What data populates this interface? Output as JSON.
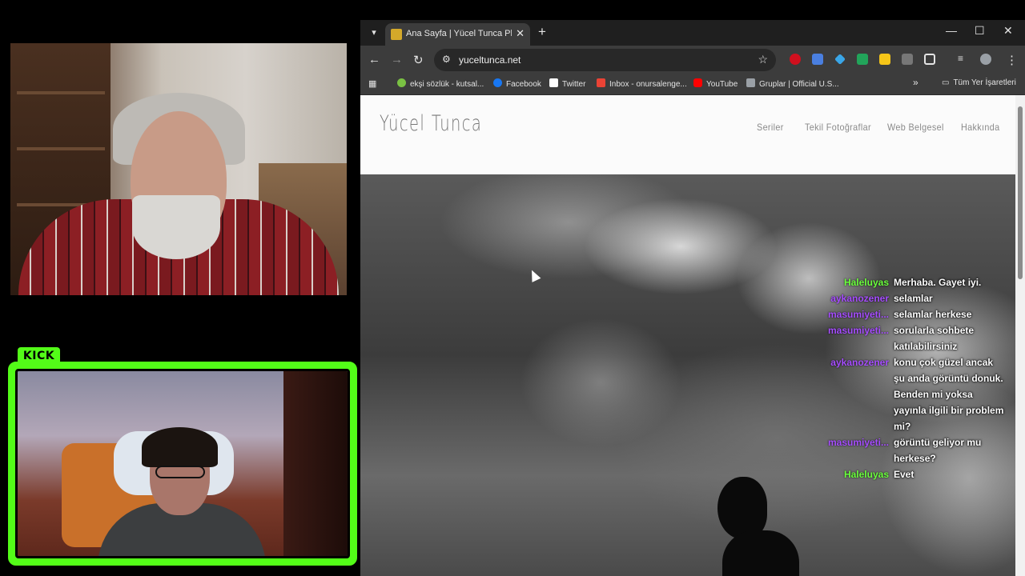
{
  "kick_label": "KICK",
  "browser": {
    "tab_list_icon": "chevron-down-icon",
    "tab": {
      "title": "Ana Sayfa | Yücel Tunca Photog",
      "close": "✕"
    },
    "new_tab": "+",
    "window_controls": {
      "minimize": "—",
      "maximize": "☐",
      "close": "✕"
    },
    "address": {
      "url": "yuceltunca.net"
    },
    "bookmarks": [
      {
        "label": "ekşi sözlük - kutsal...",
        "color": "#7ac143"
      },
      {
        "label": "Facebook",
        "color": "#1877f2"
      },
      {
        "label": "Twitter",
        "color": "#ffffff"
      },
      {
        "label": "Inbox - onursalenge...",
        "color": "#ea4335"
      },
      {
        "label": "YouTube",
        "color": "#ff0000"
      },
      {
        "label": "Gruplar | Official U.S...",
        "color": "#9aa0a6"
      }
    ],
    "bookmarks_overflow": "»",
    "all_bookmarks": "Tüm Yer İşaretleri"
  },
  "site": {
    "logo": "Yücel Tunca",
    "menu": [
      "Seriler",
      "Tekil Fotoğraflar",
      "Web Belgesel",
      "Hakkında"
    ]
  },
  "chat": [
    {
      "user": "Haleluyas",
      "text": "Merhaba. Gayet iyi.",
      "color": "#6bff3d"
    },
    {
      "user": "aykanozener",
      "text": "selamlar",
      "color": "#a64dff"
    },
    {
      "user": "masumiyeti...",
      "text": "selamlar herkese",
      "color": "#a64dff"
    },
    {
      "user": "masumiyeti...",
      "text": "sorularla sohbete katılabilirsiniz",
      "color": "#a64dff"
    },
    {
      "user": "aykanozener",
      "text": "konu çok güzel ancak şu anda görüntü donuk. Benden mi yoksa yayınla ilgili bir problem mi?",
      "color": "#a64dff"
    },
    {
      "user": "masumiyeti...",
      "text": "görüntü geliyor mu herkese?",
      "color": "#a64dff"
    },
    {
      "user": "Haleluyas",
      "text": "Evet",
      "color": "#6bff3d"
    }
  ]
}
